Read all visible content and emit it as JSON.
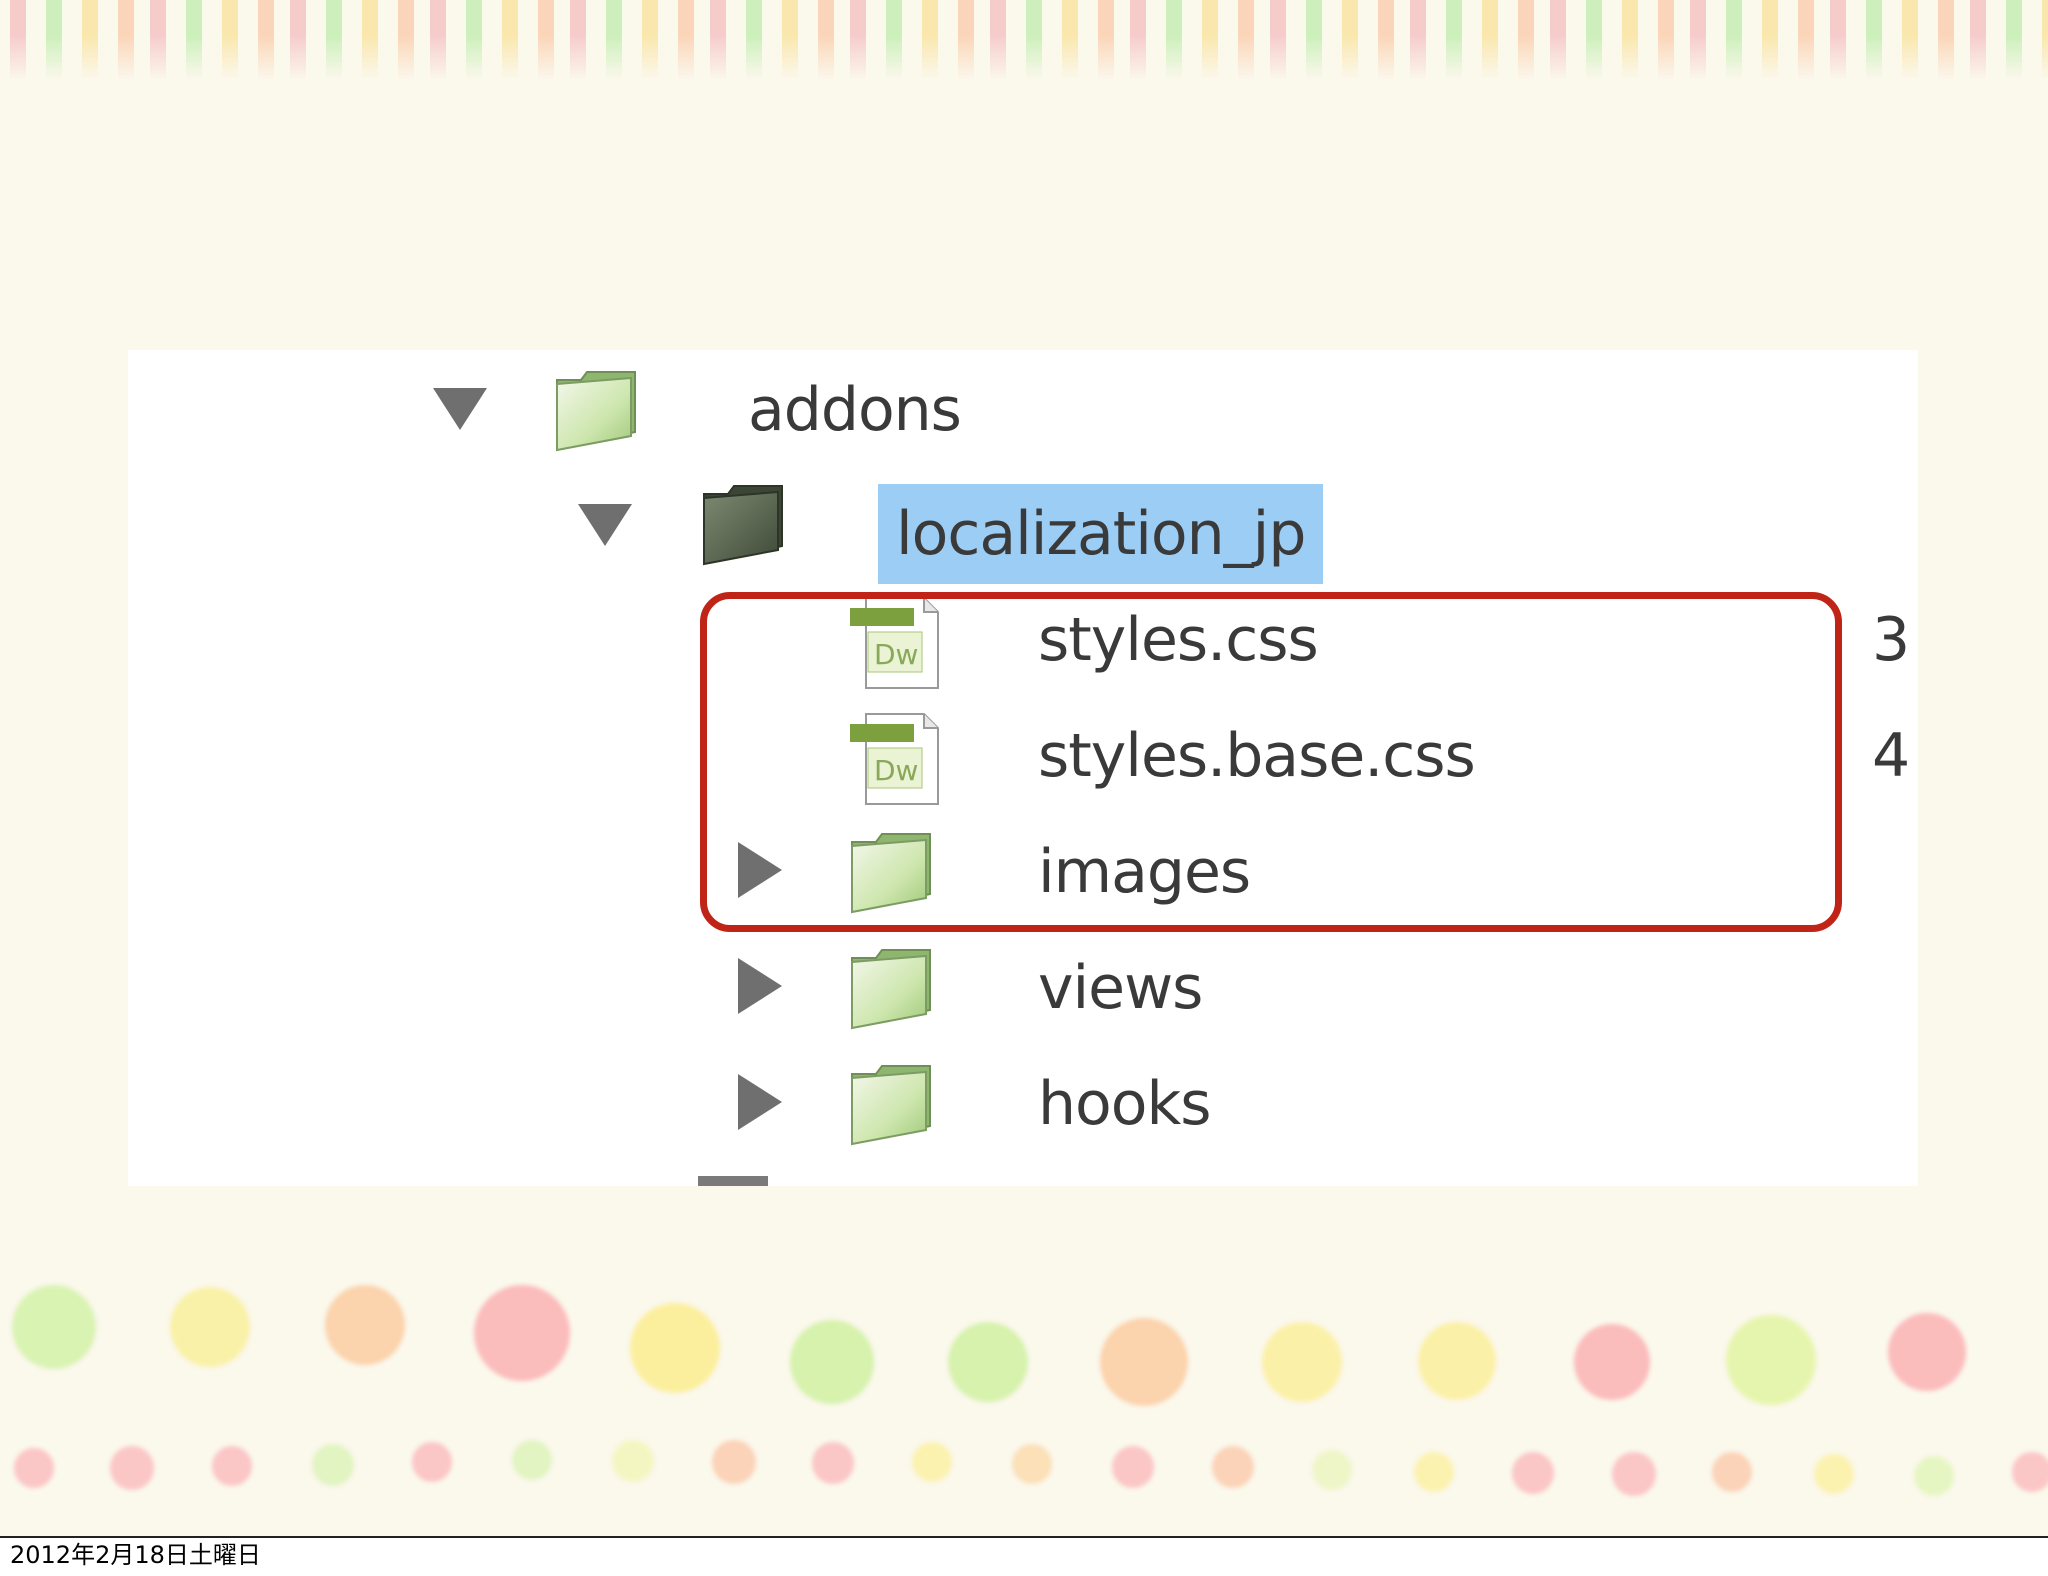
{
  "tree": {
    "root": {
      "label": "addons",
      "expanded": true
    },
    "child": {
      "label": "localization_jp",
      "expanded": true,
      "selected": true
    },
    "items": [
      {
        "label": "styles.css",
        "type": "file",
        "size_partial": "3"
      },
      {
        "label": "styles.base.css",
        "type": "file",
        "size_partial": "4"
      },
      {
        "label": "images",
        "type": "folder",
        "expanded": false
      },
      {
        "label": "views",
        "type": "folder",
        "expanded": false
      },
      {
        "label": "hooks",
        "type": "folder",
        "expanded": false
      }
    ],
    "file_icon_badge": "Dw"
  },
  "footer": {
    "timestamp": "2012年2月18日土曜日"
  },
  "colors": {
    "selection": "#9ccdf5",
    "highlight_border": "#c02416",
    "folder_green": "#b5dd8e",
    "slide_background": "#fbf8ec"
  }
}
